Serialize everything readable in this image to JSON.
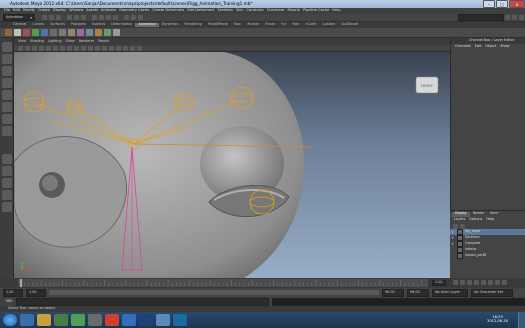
{
  "titlebar": {
    "title": "Autodesk Maya 2012 x64: C:\\Users\\Sanjar\\Documents\\maya\\projects\\default\\scenes\\Rigg_Animation_Training1.mb*"
  },
  "menubar": {
    "items": [
      "File",
      "Edit",
      "Modify",
      "Create",
      "Display",
      "Window",
      "Assets",
      "Animate",
      "Geometry Cache",
      "Create Deformers",
      "Edit Deformers",
      "Skeleton",
      "Skin",
      "Constrain",
      "Character",
      "Muscle",
      "Pipeline Cache",
      "Help"
    ]
  },
  "statusline": {
    "mode": "Animation"
  },
  "shelf": {
    "tabs": [
      "General",
      "Curves",
      "Surfaces",
      "Polygons",
      "Subdivs",
      "Deformation",
      "Animation",
      "Dynamics",
      "Rendering",
      "PaintEffects",
      "Toon",
      "Muscle",
      "Fluids",
      "Fur",
      "Hair",
      "nCloth",
      "Custom",
      "GoZBrush"
    ],
    "active": "Animation"
  },
  "panel": {
    "menu": [
      "View",
      "Shading",
      "Lighting",
      "Show",
      "Renderer",
      "Panels"
    ]
  },
  "viewcube": {
    "label": "FRONT"
  },
  "channelbox": {
    "title": "Channel Box / Layer Editor",
    "menu": [
      "Channels",
      "Edit",
      "Object",
      "Show"
    ]
  },
  "layereditor": {
    "tabs": [
      "Display",
      "Render",
      "Anim"
    ],
    "active": "Display",
    "menu": [
      "Layers",
      "Options",
      "Help"
    ],
    "layers": [
      {
        "v": "V",
        "name": "Rig_Layer",
        "selected": true
      },
      {
        "v": "V",
        "name": "Dbuttons",
        "selected": false
      },
      {
        "v": "V",
        "name": "Complete",
        "selected": false
      },
      {
        "v": "",
        "name": "Interior",
        "selected": false
      },
      {
        "v": "",
        "name": "Spears_partB",
        "selected": false
      }
    ]
  },
  "timeslider": {
    "current": "1.00"
  },
  "rangeslider": {
    "start": "1.00",
    "start2": "1.00",
    "end": "96.00",
    "end2": "96.00",
    "anim_layer": "No Anim Layer",
    "char_set": "No Character Set"
  },
  "cmdline": {
    "label": "MEL"
  },
  "helpline": {
    "text": "Select Tool: select an object"
  },
  "taskbar": {
    "clock_time": "16:29",
    "clock_date": "2012-06-30"
  }
}
